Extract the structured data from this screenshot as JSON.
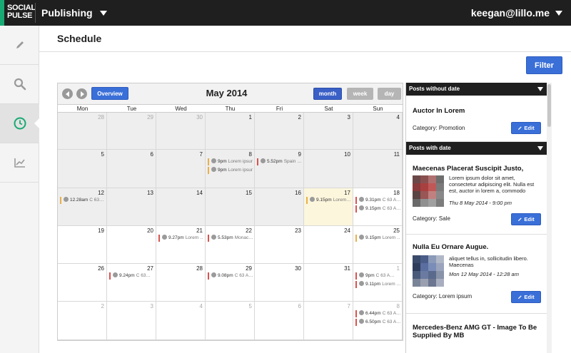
{
  "topbar": {
    "logo_line1": "SOCIAL",
    "logo_line2": "PULSE",
    "app_menu_label": "Publishing",
    "user_label": "keegan@lillo.me"
  },
  "sidenav": {
    "items": [
      {
        "icon": "pencil-icon",
        "active": false
      },
      {
        "icon": "search-icon",
        "active": false
      },
      {
        "icon": "clock-icon",
        "active": true
      },
      {
        "icon": "chart-icon",
        "active": false
      }
    ]
  },
  "page": {
    "title": "Schedule",
    "filter_label": "Filter"
  },
  "calendar": {
    "title": "May 2014",
    "overview_label": "Overview",
    "view_month": "month",
    "view_week": "week",
    "view_day": "day",
    "weekdays": [
      "Mon",
      "Tue",
      "Wed",
      "Thu",
      "Fri",
      "Sat",
      "Sun"
    ],
    "weeks": [
      [
        {
          "day": "28",
          "state": "other-past"
        },
        {
          "day": "29",
          "state": "other-past"
        },
        {
          "day": "30",
          "state": "other-past"
        },
        {
          "day": "1",
          "state": "past"
        },
        {
          "day": "2",
          "state": "past"
        },
        {
          "day": "3",
          "state": "past"
        },
        {
          "day": "4",
          "state": "past"
        }
      ],
      [
        {
          "day": "5",
          "state": "past"
        },
        {
          "day": "6",
          "state": "past"
        },
        {
          "day": "7",
          "state": "past"
        },
        {
          "day": "8",
          "state": "past",
          "events": [
            {
              "time": "9pm",
              "text": "Lorem ipsum…",
              "color": "#e8b04a"
            },
            {
              "time": "9pm",
              "text": "Lorem ipsum…",
              "color": "#e8b04a"
            }
          ]
        },
        {
          "day": "9",
          "state": "past",
          "events": [
            {
              "time": "5.52pm",
              "text": "Spain …",
              "color": "#d9534f"
            }
          ]
        },
        {
          "day": "10",
          "state": "past"
        },
        {
          "day": "11",
          "state": "past"
        }
      ],
      [
        {
          "day": "12",
          "state": "past",
          "events": [
            {
              "time": "12.28am",
              "text": "C 63…",
              "color": "#e8b04a"
            }
          ]
        },
        {
          "day": "13",
          "state": "past"
        },
        {
          "day": "14",
          "state": "past"
        },
        {
          "day": "15",
          "state": "past"
        },
        {
          "day": "16",
          "state": "past"
        },
        {
          "day": "17",
          "state": "today",
          "events": [
            {
              "time": "9.15pm",
              "text": "Lorem…",
              "color": "#e8b04a"
            }
          ]
        },
        {
          "day": "18",
          "state": "future",
          "events": [
            {
              "time": "9.31pm",
              "text": "C 63 A…",
              "color": "#d9534f"
            },
            {
              "time": "9.15pm",
              "text": "C 63 A…",
              "color": "#d9534f"
            }
          ]
        }
      ],
      [
        {
          "day": "19",
          "state": "future"
        },
        {
          "day": "20",
          "state": "future"
        },
        {
          "day": "21",
          "state": "future",
          "events": [
            {
              "time": "9.27pm",
              "text": "Lorem …",
              "color": "#d9534f"
            }
          ]
        },
        {
          "day": "22",
          "state": "future",
          "events": [
            {
              "time": "5.53pm",
              "text": "Monac…",
              "color": "#d9534f"
            }
          ]
        },
        {
          "day": "23",
          "state": "future"
        },
        {
          "day": "24",
          "state": "future"
        },
        {
          "day": "25",
          "state": "future",
          "events": [
            {
              "time": "9.15pm",
              "text": "Lorem …",
              "color": "#e8b04a"
            }
          ]
        }
      ],
      [
        {
          "day": "26",
          "state": "future"
        },
        {
          "day": "27",
          "state": "future",
          "events": [
            {
              "time": "9.24pm",
              "text": "C 63…",
              "color": "#d9534f"
            }
          ]
        },
        {
          "day": "28",
          "state": "future"
        },
        {
          "day": "29",
          "state": "future",
          "events": [
            {
              "time": "9.08pm",
              "text": "C 63 A…",
              "color": "#d9534f"
            }
          ]
        },
        {
          "day": "30",
          "state": "future"
        },
        {
          "day": "31",
          "state": "future"
        },
        {
          "day": "1",
          "state": "other",
          "events": [
            {
              "time": "9pm",
              "text": "C 63 A…",
              "color": "#d9534f"
            },
            {
              "time": "9.11pm",
              "text": "Lorem …",
              "color": "#d9534f"
            }
          ]
        }
      ],
      [
        {
          "day": "2",
          "state": "other"
        },
        {
          "day": "3",
          "state": "other"
        },
        {
          "day": "4",
          "state": "other"
        },
        {
          "day": "5",
          "state": "other"
        },
        {
          "day": "6",
          "state": "other"
        },
        {
          "day": "7",
          "state": "other"
        },
        {
          "day": "8",
          "state": "other",
          "events": [
            {
              "time": "6.44pm",
              "text": "C 63 A…",
              "color": "#d9534f"
            },
            {
              "time": "6.50pm",
              "text": "C 63 A…",
              "color": "#d9534f"
            }
          ]
        }
      ]
    ]
  },
  "panel": {
    "without_date_header": "Posts without date",
    "with_date_header": "Posts with date",
    "undated_post": {
      "title": "Auctor In Lorem",
      "category": "Category: Promotion",
      "edit": "Edit"
    },
    "posts": [
      {
        "title": "Maecenas Placerat Suscipit Justo,",
        "body": "Lorem ipsum dolor sit amet, consectetur adipiscing elit. Nulla est est, auctor in lorem a, commodo",
        "date": "Thu 8 May 2014 - 9:00 pm",
        "category": "Category: Sale",
        "edit": "Edit",
        "thumb": [
          "#6a4848",
          "#8a5050",
          "#b07070",
          "#6e6e6e",
          "#8a3a3a",
          "#a84040",
          "#c05858",
          "#7a7a7a",
          "#5a4444",
          "#9a5555",
          "#c08080",
          "#888888",
          "#6a6a6a",
          "#909090",
          "#a0a0a0",
          "#7c7c7c"
        ]
      },
      {
        "title": "Nulla Eu Ornare Augue.",
        "body": "aliquet tellus in, sollicitudin libero. Maecenas",
        "date": "Mon 12 May 2014 - 12:28 am",
        "category": "Category: Lorem ipsum",
        "edit": "Edit",
        "thumb": [
          "#3a4a6a",
          "#4a5c88",
          "#8a9ab8",
          "#b0b8c8",
          "#2e3c5c",
          "#5a6ea0",
          "#7a8cb8",
          "#9aa4bc",
          "#4a5a7a",
          "#6a7aa0",
          "#5a6a8c",
          "#8892a8",
          "#7a8498",
          "#9aa0b0",
          "#6c7690",
          "#a8aec0"
        ]
      },
      {
        "title": "Mercedes-Benz AMG GT - Image To Be Supplied By MB"
      }
    ]
  }
}
